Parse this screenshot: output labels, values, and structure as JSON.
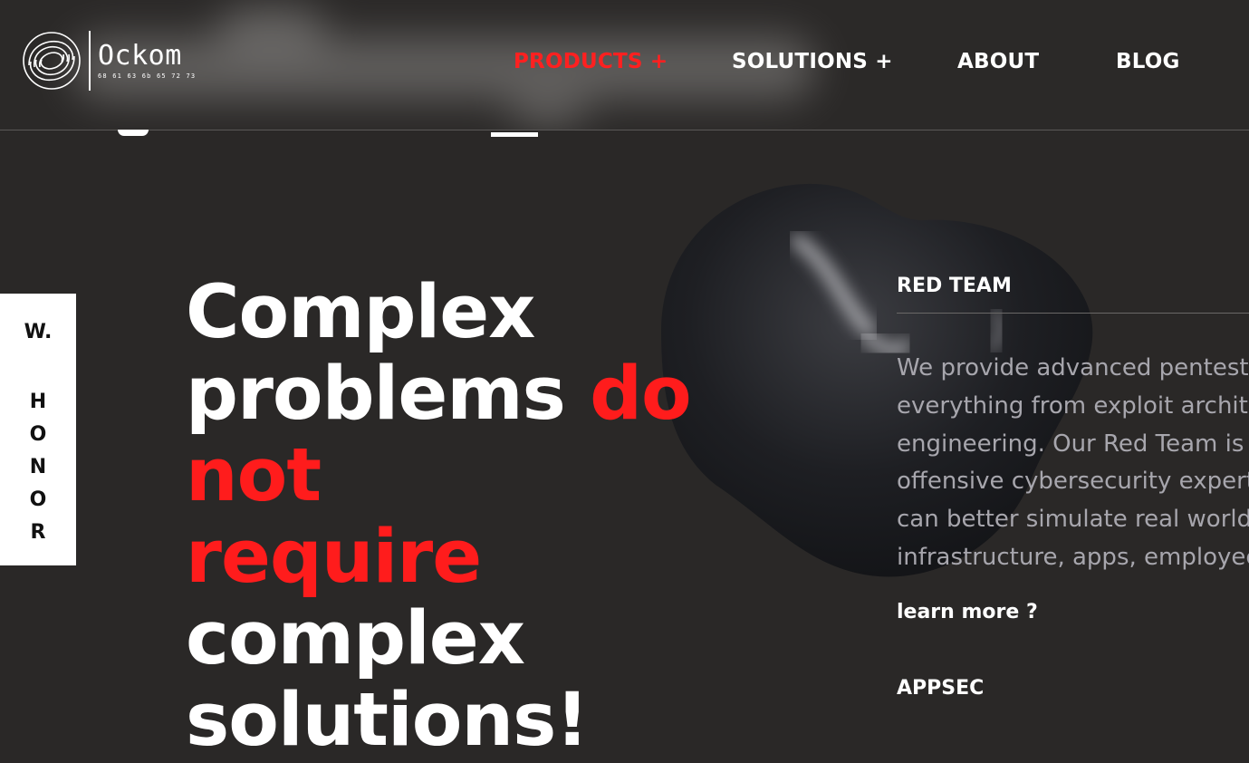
{
  "brand": {
    "name": "Ockom",
    "hex": "68 61 63 6b 65 72 73"
  },
  "nav": {
    "products": "PRODUCTS +",
    "solutions": "SOLUTIONS +",
    "about": "ABOUT",
    "blog": "BLOG"
  },
  "side_tab": {
    "top": "W.",
    "letters": [
      "H",
      "O",
      "N",
      "O",
      "R"
    ]
  },
  "hero": {
    "line1": "Complex",
    "line2_white": "problems ",
    "line2_red": "do not",
    "line3_red": "require",
    "line3_white": " complex",
    "line4": "solutions!"
  },
  "red_team": {
    "title": "RED TEAM",
    "lines": [
      "We provide advanced pentest",
      "everything from exploit archit",
      "engineering. Our Red Team is",
      "offensive cybersecurity expert",
      "can better simulate real world",
      "infrastructure, apps, employee"
    ],
    "link": "learn more ?"
  },
  "appsec": {
    "title": "APPSEC"
  },
  "colors": {
    "background": "#2a2827",
    "accent": "#ff1c1c",
    "body_text": "#a7a6ad",
    "side_tab": "#ffffff"
  }
}
